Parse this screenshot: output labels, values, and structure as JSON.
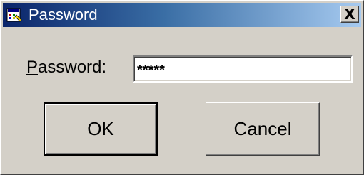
{
  "window": {
    "title": "Password",
    "icon": "password-app-icon",
    "close_symbol": "X"
  },
  "form": {
    "label_mnemonic": "P",
    "label_rest": "assword:",
    "value": "*****"
  },
  "buttons": {
    "ok_label": "OK",
    "cancel_label": "Cancel"
  },
  "colors": {
    "titlebar_start": "#0a246a",
    "titlebar_end": "#a6caf0",
    "face": "#d4d0c8"
  }
}
